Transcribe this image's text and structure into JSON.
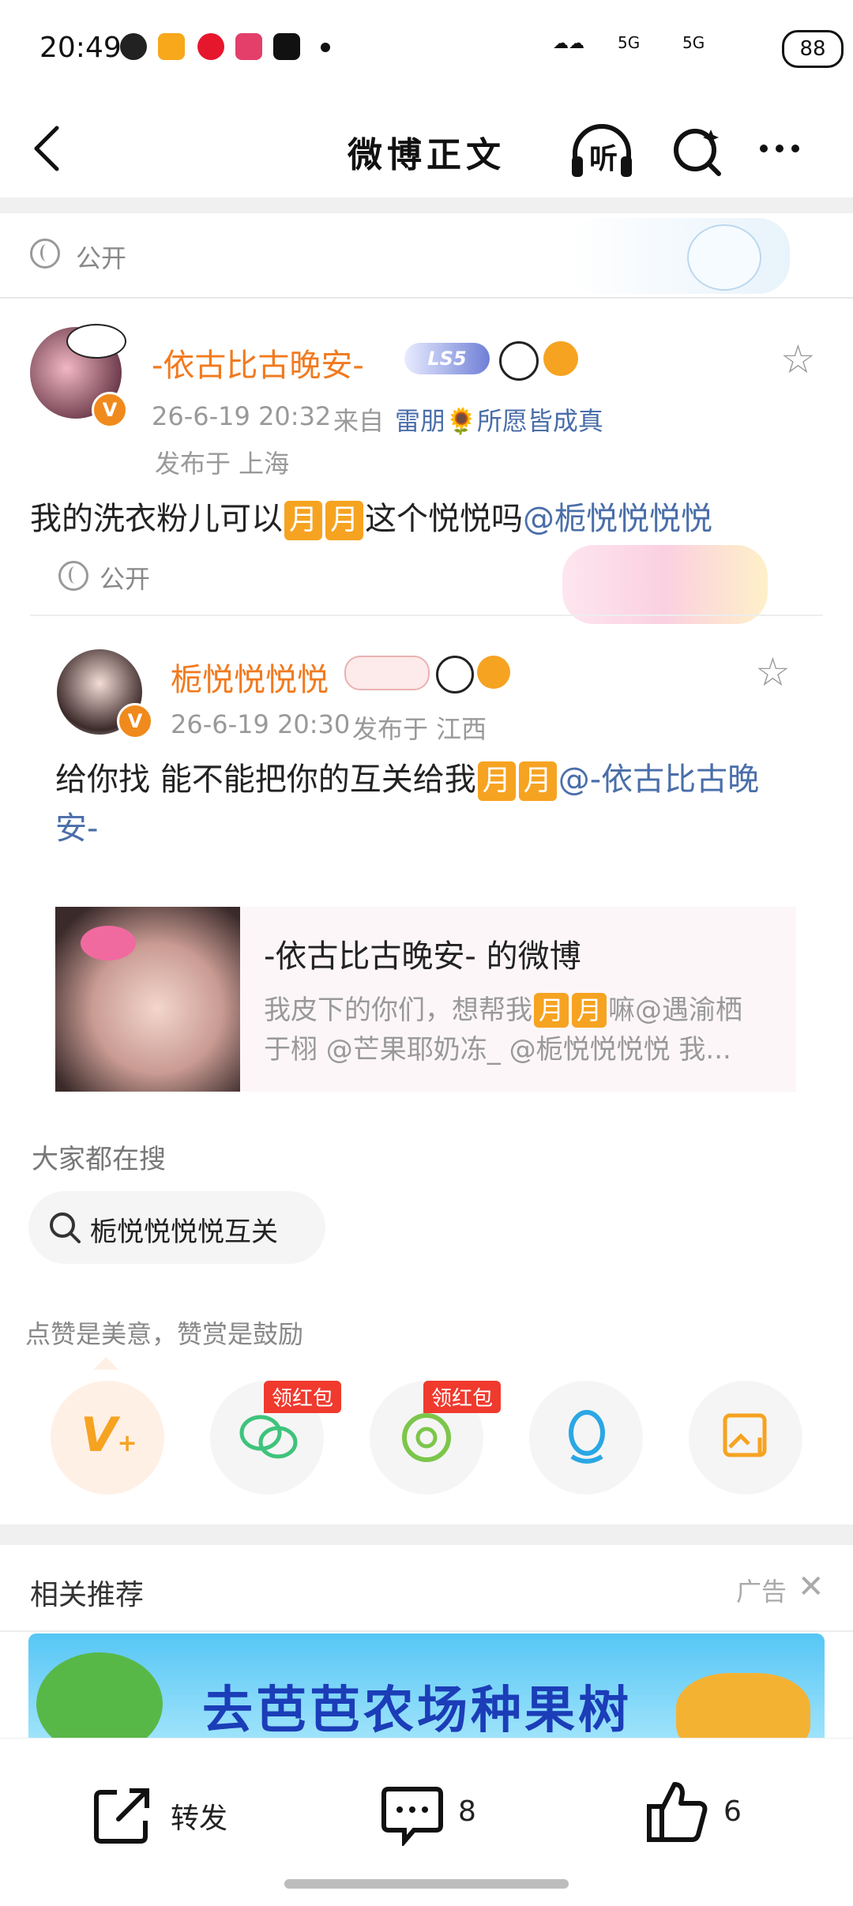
{
  "status_bar": {
    "time": "20:49",
    "network": "5G",
    "network2": "5G",
    "battery": "88"
  },
  "nav": {
    "back_icon": "chevron-left-icon",
    "title": "微博正文",
    "listen_label": "听",
    "more_icon": "more-dots-icon"
  },
  "visibility": {
    "label": "公开"
  },
  "post": {
    "author": "-依古比古晚安-",
    "level": "LS5",
    "time": "26-6-19 20:32",
    "source_prefix": "来自",
    "source": "雷朋🌻所愿皆成真",
    "location": "发布于 上海",
    "text_before": "我的洗衣粉儿可以",
    "moon": "月",
    "text_mid": "这个悦悦吗",
    "mention": "@栀悦悦悦悦",
    "visibility": "公开"
  },
  "repost": {
    "author": "栀悦悦悦悦",
    "time": "26-6-19 20:30",
    "location": "发布于 江西",
    "text_before": "给你找 能不能把你的互关给我",
    "moon": "月",
    "mention": "@-依古比古晚安-",
    "card": {
      "title": "-依古比古晚安- 的微博",
      "desc_before": "我皮下的你们，想帮我",
      "desc_after": "嘛@遇渝栖于栩 @芒果耶奶冻_ @栀悦悦悦悦 我..."
    }
  },
  "search": {
    "heading": "大家都在搜",
    "chip": "栀悦悦悦悦互关"
  },
  "tips": {
    "heading": "点赞是美意，赞赏是鼓励",
    "buttons": [
      {
        "icon": "v-plus-icon"
      },
      {
        "icon": "wechat-icon",
        "tag": "领红包"
      },
      {
        "icon": "moments-icon",
        "tag": "领红包"
      },
      {
        "icon": "qq-icon"
      },
      {
        "icon": "save-image-icon"
      }
    ]
  },
  "related": {
    "heading": "相关推荐",
    "ad_label": "广告",
    "banner_text": "去芭芭农场种果树"
  },
  "bottom_bar": {
    "repost_label": "转发",
    "comment_count": "8",
    "like_count": "6"
  }
}
